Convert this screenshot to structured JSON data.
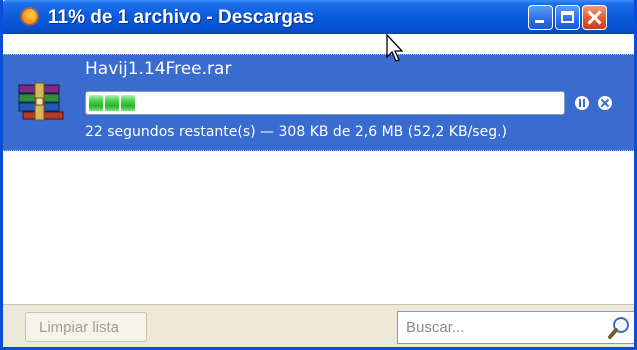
{
  "window": {
    "title": "11% de 1 archivo - Descargas",
    "app_icon": "firefox-icon",
    "controls": [
      "minimize-icon",
      "maximize-icon",
      "close-icon"
    ]
  },
  "download": {
    "filename": "Havij1.14Free.rar",
    "file_icon": "winrar-archive-icon",
    "progress_fraction": 0.11,
    "status": "22 segundos restante(s) — 308 KB de 2,6 MB (52,2 KB/seg.)",
    "actions": [
      "pause-icon",
      "cancel-icon"
    ]
  },
  "footer": {
    "clear_button": "Limpiar lista",
    "search_placeholder": "Buscar..."
  },
  "colors": {
    "titlebar": "#0653d4",
    "selected_row": "#3a6ccf",
    "progress_green": "#2bb52b",
    "footer_bg": "#ece9d8"
  }
}
